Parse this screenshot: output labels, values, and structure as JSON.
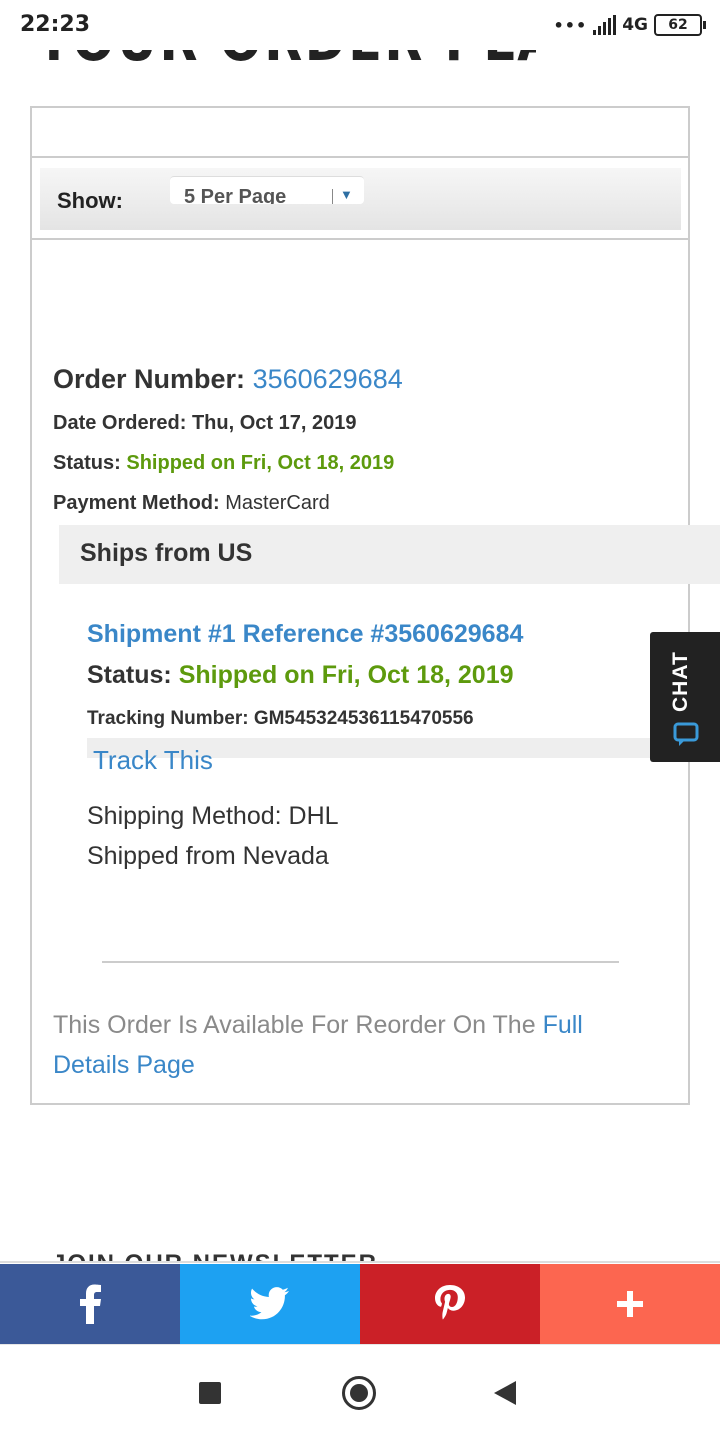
{
  "status_bar": {
    "time": "22:23",
    "dots": "•••",
    "network": "4G",
    "battery": "62"
  },
  "page": {
    "heading": "YOUR ORDER PLACED."
  },
  "filter": {
    "show_label": "Show:",
    "per_page_value": "5 Per Page"
  },
  "order": {
    "number_label": "Order Number:",
    "number": "3560629684",
    "date_label": "Date Ordered:",
    "date": "Thu, Oct 17, 2019",
    "status_label": "Status:",
    "status": "Shipped on Fri, Oct 18, 2019",
    "payment_label": "Payment Method:",
    "payment": "MasterCard",
    "ships_from": "Ships from US"
  },
  "shipment": {
    "title": "Shipment #1 Reference #3560629684",
    "status_label": "Status:",
    "status": "Shipped on Fri, Oct 18, 2019",
    "tracking_label": "Tracking Number:",
    "tracking_number": "GM545324536115470556",
    "track_link": "Track This",
    "shipping_method": "Shipping Method: DHL",
    "shipped_from": "Shipped from Nevada"
  },
  "reorder": {
    "text": "This Order Is Available For Reorder On The",
    "link": "Full Details Page"
  },
  "chat": {
    "label": "CHAT",
    "icon": "chat-bubble-icon"
  },
  "newsletter": {
    "heading": "JOIN OUR NEWSLETTER"
  },
  "share": {
    "buttons": [
      {
        "icon": "facebook-icon",
        "color": "#3b5998"
      },
      {
        "icon": "twitter-icon",
        "color": "#1da1f2"
      },
      {
        "icon": "pinterest-icon",
        "color": "#cb2027"
      },
      {
        "icon": "plus-icon",
        "color": "#fc6650"
      }
    ]
  },
  "colors": {
    "link": "#3a87c8",
    "status_green": "#5d9a0d",
    "chat_bg": "#222222"
  }
}
